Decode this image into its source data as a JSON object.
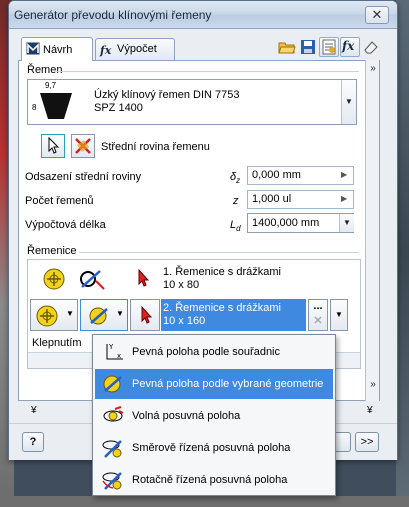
{
  "window": {
    "title": "Generátor převodu klínovými řemeny",
    "close_glyph": "✕"
  },
  "tabs": [
    {
      "label": "Návrh",
      "icon": "design-tab-icon",
      "active": true
    },
    {
      "label": "Výpočet",
      "icon": "calculation-tab-icon",
      "active": false
    }
  ],
  "toolbar_icons": [
    "open-folder-icon",
    "save-icon",
    "options-icon",
    "fx-icon",
    "eraser-icon"
  ],
  "belt_section": {
    "title": "Řemen",
    "belt_name_line1": "Úzký klínový řemen DIN 7753",
    "belt_name_line2": "SPZ 1400",
    "thumb_dim_top": "9,7",
    "thumb_dim_side": "8",
    "mid_plane_label": "Střední rovina řemenu",
    "fields": [
      {
        "label": "Odsazení střední roviny",
        "symbol": "δ",
        "symbol_sub": "z",
        "value": "0,000 mm"
      },
      {
        "label": "Počet řemenů",
        "symbol": "z",
        "symbol_sub": "",
        "value": "1,000 ul"
      },
      {
        "label": "Výpočtová délka",
        "symbol": "L",
        "symbol_sub": "d",
        "value": "1400,000 mm"
      }
    ]
  },
  "pulleys_section": {
    "title": "Řemenice",
    "rows": [
      {
        "line1": "1. Řemenice s drážkami",
        "line2": "10 x 80",
        "selected": false
      },
      {
        "line1": "2. Řemenice s drážkami",
        "line2": "10 x 160",
        "selected": true
      }
    ],
    "row_more": "...",
    "status_text": "Klepnutím"
  },
  "bottom": {
    "help_glyph": "?",
    "next_glyph": ">>"
  },
  "dropdown": {
    "items": [
      {
        "label": "Pevná poloha podle souřadnic",
        "icon": "coordinate-position-icon",
        "highlighted": false
      },
      {
        "label": "Pevná poloha podle vybrané geometrie",
        "icon": "geometry-position-icon",
        "highlighted": true
      },
      {
        "label": "Volná posuvná poloha",
        "icon": "free-sliding-position-icon",
        "highlighted": false
      },
      {
        "label": "Směrově řízená posuvná poloha",
        "icon": "directional-sliding-position-icon",
        "highlighted": false
      },
      {
        "label": "Rotačně řízená posuvná poloha",
        "icon": "rotational-sliding-position-icon",
        "highlighted": false
      }
    ]
  },
  "colors": {
    "selection": "#3f8ae0",
    "accent_red": "#d02020",
    "accent_yellow": "#f2d21b"
  }
}
